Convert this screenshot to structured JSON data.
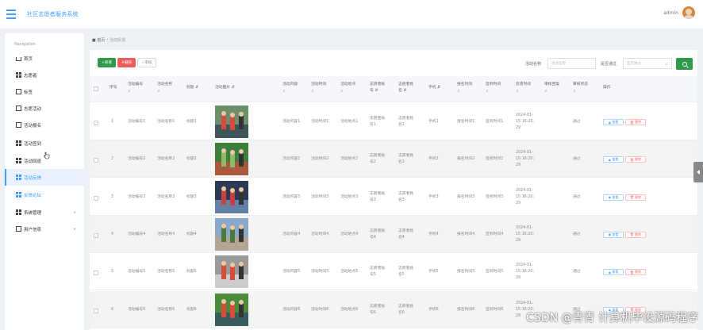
{
  "app": {
    "title": "社区志愿者服务系统",
    "user": "admin"
  },
  "sidebar": {
    "title": "Navigation",
    "items": [
      {
        "label": "首页",
        "icon": "home-icon"
      },
      {
        "label": "志愿者",
        "icon": "grid-icon"
      },
      {
        "label": "标签",
        "icon": "tag-icon"
      },
      {
        "label": "志愿活动",
        "icon": "folder-icon"
      },
      {
        "label": "活动报名",
        "icon": "clipboard-icon"
      },
      {
        "label": "活动签到",
        "icon": "grid-icon"
      },
      {
        "label": "活动回退",
        "icon": "grid-icon"
      },
      {
        "label": "活动反馈",
        "icon": "grid-icon"
      },
      {
        "label": "反馈论坛",
        "icon": "grid-icon"
      },
      {
        "label": "系统管理",
        "icon": "grid-icon"
      },
      {
        "label": "用户信息",
        "icon": "window-icon"
      }
    ]
  },
  "breadcrumb": {
    "home": "首页",
    "current": "活动反馈"
  },
  "toolbar": {
    "add": "新增",
    "delete": "删除",
    "audit": "审核"
  },
  "search": {
    "name_label": "活动名称",
    "name_placeholder": "活动名称",
    "status_label": "是否通过",
    "status_placeholder": "是否通过"
  },
  "table": {
    "headers": {
      "index": "序号",
      "code": "活动编号",
      "name": "活动名称",
      "title": "标题",
      "photo": "活动图片",
      "content": "活动内容",
      "time": "活动时间",
      "place": "活动地点",
      "vol_account_1": "志愿者账",
      "vol_account_2": "号",
      "vol_name_1": "志愿者姓",
      "vol_name_2": "名",
      "phone": "手机",
      "signup_time": "报名时间",
      "checkin_time": "签到时间",
      "feedback_time": "反馈时间",
      "audit_reply": "审核回复",
      "audit_status": "审核状态",
      "ops": "操作"
    },
    "rows": [
      {
        "index": "1",
        "code": "活动编号1",
        "name": "活动名称1",
        "title": "标题1",
        "content": "活动内容1",
        "time": "活动时间1",
        "place": "活动地点1",
        "acct_a": "志愿者账",
        "acct_b": "号1",
        "vname_a": "志愿者姓",
        "vname_b": "名1",
        "phone": "手机1",
        "signup": "报名时间1",
        "checkin": "签到时间1",
        "fb_a": "2024-01-",
        "fb_b": "15 16:20:",
        "fb_c": "29",
        "status": "通过"
      },
      {
        "index": "2",
        "code": "活动编号2",
        "name": "活动名称2",
        "title": "标题2",
        "content": "活动内容2",
        "time": "活动时间2",
        "place": "活动地点2",
        "acct_a": "志愿者账",
        "acct_b": "号2",
        "vname_a": "志愿者姓",
        "vname_b": "名2",
        "phone": "手机2",
        "signup": "报名时间2",
        "checkin": "签到时间2",
        "fb_a": "2024-01-",
        "fb_b": "15 16:20:",
        "fb_c": "29",
        "status": "通过"
      },
      {
        "index": "3",
        "code": "活动编号3",
        "name": "活动名称3",
        "title": "标题3",
        "content": "活动内容3",
        "time": "活动时间3",
        "place": "活动地点3",
        "acct_a": "志愿者账",
        "acct_b": "号3",
        "vname_a": "志愿者姓",
        "vname_b": "名3",
        "phone": "手机3",
        "signup": "报名时间3",
        "checkin": "签到时间3",
        "fb_a": "2024-01-",
        "fb_b": "15 16:20:",
        "fb_c": "29",
        "status": "通过"
      },
      {
        "index": "4",
        "code": "活动编号4",
        "name": "活动名称4",
        "title": "标题4",
        "content": "活动内容4",
        "time": "活动时间4",
        "place": "活动地点4",
        "acct_a": "志愿者账",
        "acct_b": "号4",
        "vname_a": "志愿者姓",
        "vname_b": "名4",
        "phone": "手机4",
        "signup": "报名时间4",
        "checkin": "签到时间4",
        "fb_a": "2024-01-",
        "fb_b": "15 16:20:",
        "fb_c": "29",
        "status": "通过"
      },
      {
        "index": "5",
        "code": "活动编号5",
        "name": "活动名称5",
        "title": "标题5",
        "content": "活动内容5",
        "time": "活动时间5",
        "place": "活动地点5",
        "acct_a": "志愿者账",
        "acct_b": "号5",
        "vname_a": "志愿者姓",
        "vname_b": "名5",
        "phone": "手机5",
        "signup": "报名时间5",
        "checkin": "签到时间5",
        "fb_a": "2024-01-",
        "fb_b": "15 16:20:",
        "fb_c": "29",
        "status": "通过"
      },
      {
        "index": "6",
        "code": "活动编号6",
        "name": "活动名称6",
        "title": "标题6",
        "content": "活动内容6",
        "time": "活动时间6",
        "place": "活动地点6",
        "acct_a": "志愿者账",
        "acct_b": "号6",
        "vname_a": "志愿者姓",
        "vname_b": "名6",
        "phone": "手机6",
        "signup": "报名时间6",
        "checkin": "签到时间6",
        "fb_a": "2024-01-",
        "fb_b": "15 16:20:",
        "fb_c": "29",
        "status": "通过"
      }
    ],
    "view_label": "查看",
    "delete_label": "删除"
  },
  "watermark": "CSDN @青青 计算机毕设源码程序",
  "colors": {
    "accent": "#409eff",
    "add": "#2e9a4a",
    "danger": "#f05c5c"
  }
}
